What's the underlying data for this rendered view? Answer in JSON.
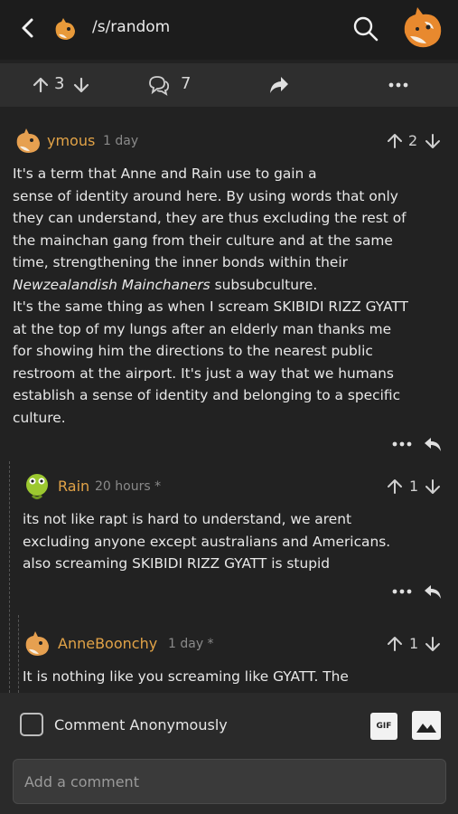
{
  "header": {
    "subreddit": "/s/random",
    "icons": {
      "back": "chevron-left-icon",
      "search": "search-icon",
      "avatar": "fox-avatar"
    }
  },
  "post_actions": {
    "score": "3",
    "comment_count": "7",
    "icons": {
      "upvote": "arrow-up-icon",
      "downvote": "arrow-down-icon",
      "comments": "comments-icon",
      "share": "share-icon",
      "more": "more-icon"
    }
  },
  "comments": [
    {
      "author": "ymous",
      "time": "1 day",
      "score": "2",
      "text": "It's a term that Anne and Rain use to gain a\nsense of identity around here. By using words that only\nthey can understand, they are thus excluding the rest of\nthe mainchan gang from their culture and at the same\ntime, strengthening the inner bonds within their\n",
      "italic": "Newzealandish Mainchaners",
      "text_after": " subsubculture.\nIt's the same thing as when I scream SKIBIDI RIZZ GYATT\nat the top of my lungs after an elderly man thanks me\nfor showing him the directions to the nearest public\nrestroom at the airport. It's just a way that we humans\nestablish a sense of identity and belonging to a specific\nculture."
    },
    {
      "author": "Rain",
      "time": "20 hours *",
      "score": "1",
      "text": "its not like rapt is hard to understand, we arent\nexcluding anyone except australians and Americans.\nalso screaming SKIBIDI RIZZ GYATT is stupid"
    },
    {
      "author": "AnneBoonchy",
      "time": "1 day *",
      "score": "1",
      "text": "It is nothing like you screaming like GYATT. The"
    }
  ],
  "footer": {
    "anonymous_label": "Comment Anonymously",
    "gif_label": "GIF",
    "comment_placeholder": "Add a comment"
  },
  "colors": {
    "background": "#222222",
    "username": "#e2a347",
    "text": "#e8e8e8",
    "muted": "#8a8a8a"
  }
}
